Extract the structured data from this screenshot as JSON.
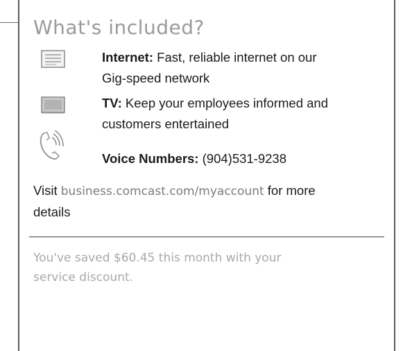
{
  "heading": "What's included?",
  "features": [
    {
      "icon": "internet-icon",
      "label": "Internet:",
      "text": "Fast, reliable internet on our",
      "text2": "Gig-speed network"
    },
    {
      "icon": "tv-icon",
      "label": "TV:",
      "text": "Keep your employees informed and",
      "text2": "customers entertained"
    },
    {
      "icon": "phone-icon",
      "label": "Voice Numbers:",
      "text": "(904)531-9238"
    }
  ],
  "visit": {
    "prefix": "Visit ",
    "link": "business.comcast.com/myaccount",
    "suffix": " for more",
    "suffix2": "details"
  },
  "savings": {
    "line1": "You've saved $60.45 this month with your",
    "line2": "service discount."
  }
}
